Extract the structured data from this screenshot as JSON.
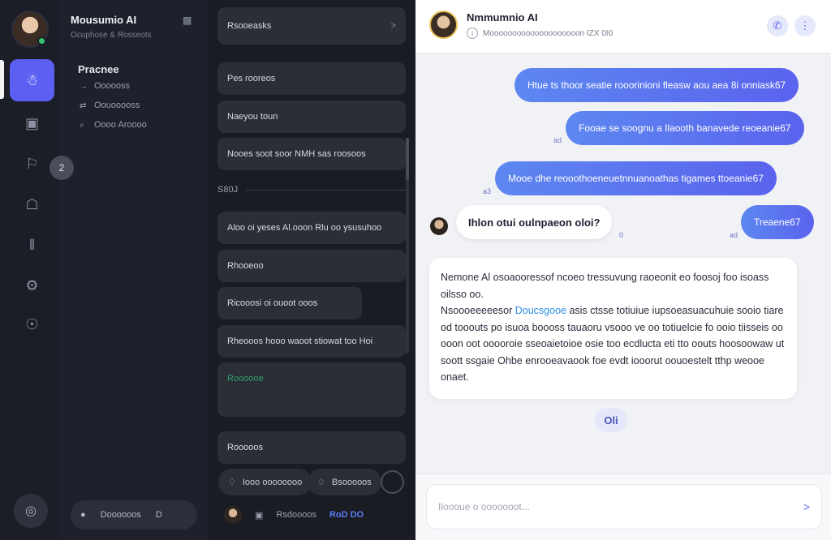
{
  "colors": {
    "accent": "#5b5ff2",
    "online": "#35c46d",
    "link": "#2d8fe6",
    "compose": "#2f9f6a"
  },
  "rail": {
    "icons": [
      "users-icon",
      "grid-icon",
      "bookmark-icon",
      "briefcase-icon",
      "columns-icon",
      "settings-icon",
      "robot-icon"
    ],
    "glyphs": [
      "☃",
      "▣",
      "⚐",
      "☖",
      "‖",
      "⚙",
      "☉"
    ],
    "badge": "2",
    "footer_icon": "◎"
  },
  "nav": {
    "title": "Mousumio AI",
    "subtitle": "Ocuphose & Rosseots",
    "section": "Pracnee",
    "items": [
      {
        "icon": "→",
        "label": "Oooooss"
      },
      {
        "icon": "⇄",
        "label": "Oouooooss"
      },
      {
        "icon": "⌕",
        "label": "Oooo Aroooo"
      }
    ],
    "footer": {
      "icon": "●",
      "label": "Doooooos",
      "chevron": "D"
    }
  },
  "list": {
    "header": "Rsooeasks",
    "header_chevron": ">",
    "items": [
      "Pes rooreos",
      "Naeyou toun",
      "Nooes soot soor NMH sas roosoos"
    ],
    "divider": "S80J",
    "items2": [
      "Aloo oi yeses Al.ooon Rlu oo ysusuhoo",
      "Rhooeoo",
      "Ricooosi oi ouoot ooos",
      "Rheooos hooo waoot stiowat too Hoi"
    ],
    "compose_label": "Roooooe",
    "action": "Rooooos",
    "pills": [
      {
        "icon": "♢",
        "label": "Iooo oooooooo"
      },
      {
        "icon": "♢",
        "label": "Bsooooos"
      }
    ],
    "footer": {
      "tab1": "▣",
      "label": "Rsdoooos",
      "accent": "RoD DO"
    }
  },
  "chat": {
    "name": "Nmmumnio AI",
    "status": "Moooooooooooooooooooon  IZX 0I0",
    "messages_out": [
      "Htue ts thoor seatie rooorinioni fleasw aou aea 8i onniask67",
      "Fooae se soognu a Ilaooth banavede reoeanie67",
      "Mooe dhe reooothoeneuetnnuanoathas tigames  ttoeanie67",
      "Treaene67"
    ],
    "ticks": [
      "ad",
      "a3",
      "0",
      "ad"
    ],
    "message_in": "Ihlon otui oulnpaeon oloi?",
    "reply_parts": [
      "Nemone Al osoaooressof ncoeo tressuvung raoeonit eo foosoj foo isoass oilsso oo.",
      "Nsoooeeeeesor ",
      "Doucsgooe",
      " asis ctsse totiuiue iupsoeasuacuhuie sooio tiare od tooouts po isuoa boooss tauaoru vsooo ve oo totiuelcie fo ooio tiisseis oo ooon oot ooooroie sseoaietoioe osie too ecdlucta eti tto oouts hoosoowaw ut soott ssgaie Ohbe enrooeavaook foe evdt iooorut oouoestelt tthp weooe onaet."
    ],
    "ok_label": "Oli",
    "composer_placeholder": "Iloooue o ooooooot...",
    "send_icon": ">"
  }
}
